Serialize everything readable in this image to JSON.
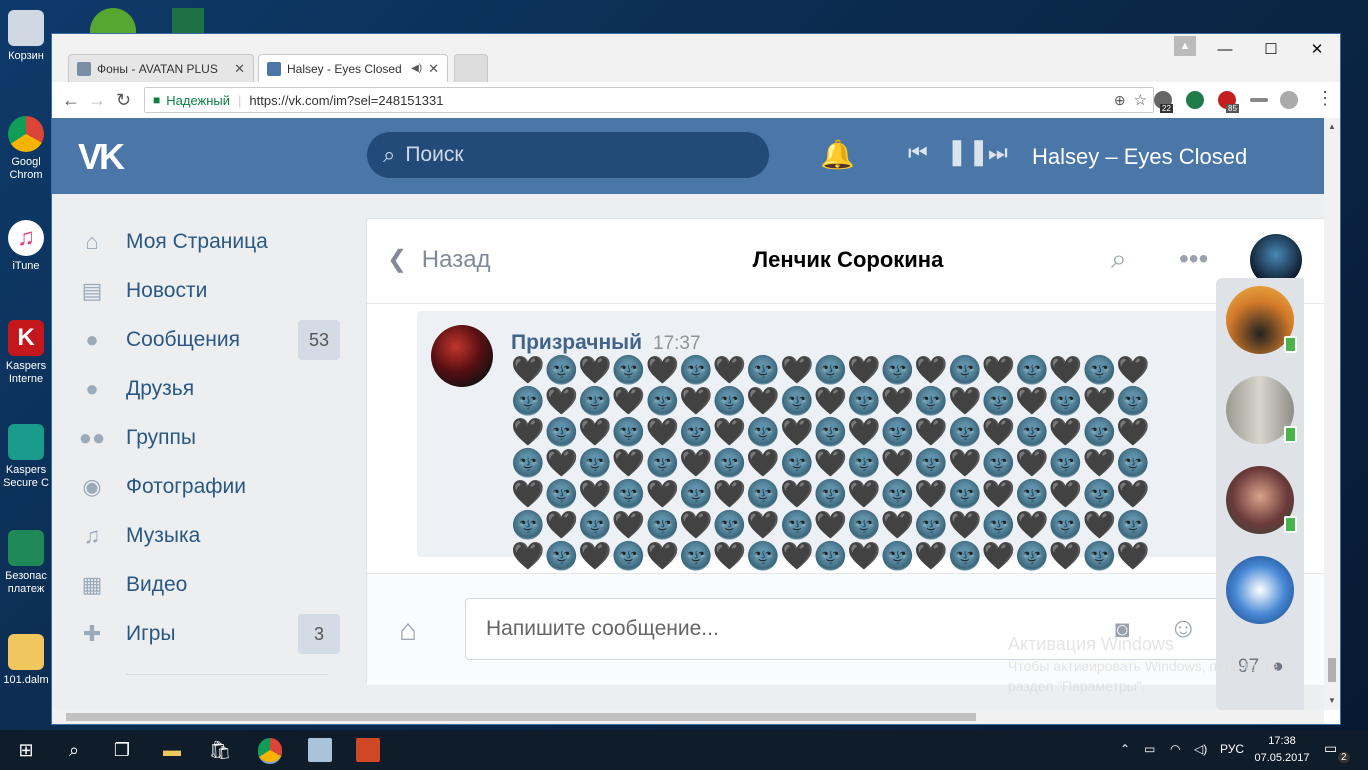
{
  "desktop": {
    "icons": [
      {
        "label": "Корзин"
      },
      {
        "label": "Googl\nChrom"
      },
      {
        "label": "iTune"
      },
      {
        "label": "Kaspers\nInterne"
      },
      {
        "label": "Kaspers\nSecure C"
      },
      {
        "label": "Безопас\nплатеж"
      },
      {
        "label": "101.dalm"
      }
    ]
  },
  "browser": {
    "tabs": [
      {
        "label": "Фоны - AVATAN PLUS",
        "close": "✕"
      },
      {
        "label": "Halsey - Eyes Closed",
        "close": "✕",
        "audio": "◀)"
      }
    ],
    "secure_label": "Надежный",
    "url": "https://vk.com/im?sel=248151331",
    "ext_badges": [
      "22",
      "85"
    ]
  },
  "vk": {
    "search_placeholder": "Поиск",
    "now_playing": "Halsey – Eyes Closed",
    "sidebar": [
      {
        "label": "Моя Страница",
        "icon": "home-icon"
      },
      {
        "label": "Новости",
        "icon": "news-icon"
      },
      {
        "label": "Сообщения",
        "icon": "messages-icon",
        "badge": "53"
      },
      {
        "label": "Друзья",
        "icon": "friends-icon"
      },
      {
        "label": "Группы",
        "icon": "groups-icon"
      },
      {
        "label": "Фотографии",
        "icon": "camera-icon"
      },
      {
        "label": "Музыка",
        "icon": "music-icon"
      },
      {
        "label": "Видео",
        "icon": "video-icon"
      },
      {
        "label": "Игры",
        "icon": "gamepad-icon",
        "badge": "3"
      }
    ],
    "chat": {
      "back_label": "Назад",
      "peer_name": "Ленчик Сорокина",
      "message": {
        "author": "Призрачный",
        "time": "17:37",
        "text": "🖤🌚🖤🌚🖤🌚🖤🌚🖤🌚🖤🌚🖤🌚🖤🌚🖤🌚🖤🌚🖤🌚🖤🌚🖤🌚🖤🌚🖤🌚🖤🌚🖤🌚🖤🌚🖤🌚🖤🌚🖤🌚🖤🌚🖤🌚🖤🌚🖤🌚🖤🌚🖤🌚🖤🌚🖤🌚🖤🌚🖤🌚🖤🌚🖤🌚🖤🌚🖤🌚🖤🌚🖤🌚🖤🌚🖤🌚🖤🌚🖤🌚🖤🌚🖤🌚🖤🌚🖤🌚🖤🌚🖤🌚🖤🌚🖤🌚🖤🌚🖤🌚🖤🌚🖤🌚🖤🌚🖤🌚🖤🌚🖤🌚🖤🌚🖤🌚🖤🌚🖤🌚🖤🌚🖤🌚🖤🌚🖤🌚🖤🌚🖤"
      },
      "compose_placeholder": "Напишите сообщение..."
    },
    "online_count": "97"
  },
  "watermark": {
    "title": "Активация Windows",
    "line1": "Чтобы активировать Windows, перейдите в",
    "line2": "раздел \"Параметры\"."
  },
  "taskbar": {
    "lang": "РУС",
    "time": "17:38",
    "date": "07.05.2017",
    "notifications": "2"
  }
}
